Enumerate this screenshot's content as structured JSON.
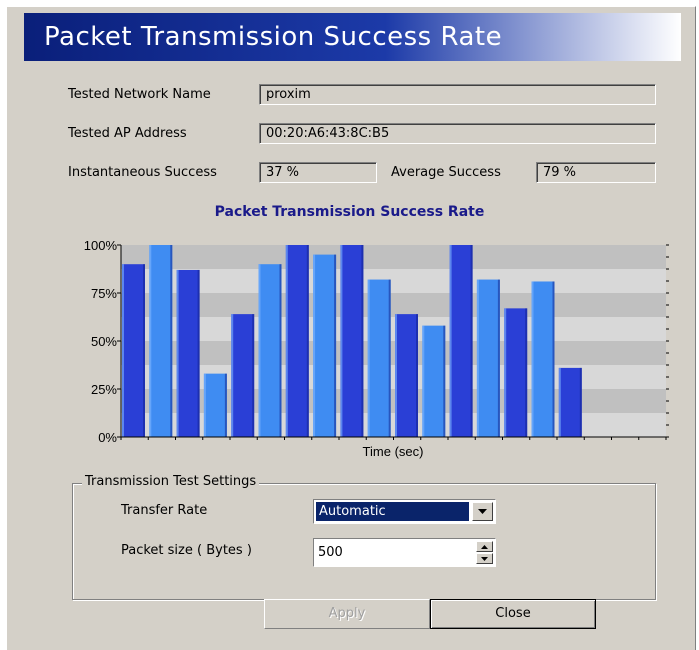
{
  "window": {
    "banner_title": "Packet Transmission Success Rate"
  },
  "info": {
    "network_name_label": "Tested Network Name",
    "network_name_value": "proxim",
    "ap_address_label": "Tested AP Address",
    "ap_address_value": "00:20:A6:43:8C:B5",
    "instant_label": "Instantaneous Success",
    "instant_value": "37 %",
    "average_label": "Average Success",
    "average_value": "79 %"
  },
  "chart_data": {
    "type": "bar",
    "title": "Packet Transmission Success Rate",
    "xlabel": "Time (sec)",
    "ylabel": "",
    "ylim": [
      0,
      100
    ],
    "yticks": [
      "0%",
      "25%",
      "50%",
      "75%",
      "100%"
    ],
    "values": [
      90,
      100,
      87,
      33,
      64,
      90,
      100,
      95,
      100,
      82,
      64,
      58,
      100,
      82,
      67,
      81,
      36
    ],
    "colors": [
      "#2a3fd6",
      "#3f8cf2"
    ],
    "grid": true
  },
  "settings": {
    "group_title": "Transmission Test Settings",
    "transfer_rate_label": "Transfer Rate",
    "transfer_rate_value": "Automatic",
    "packet_size_label": "Packet size  ( Bytes )",
    "packet_size_value": "500"
  },
  "buttons": {
    "apply_label": "Apply",
    "close_label": "Close"
  }
}
